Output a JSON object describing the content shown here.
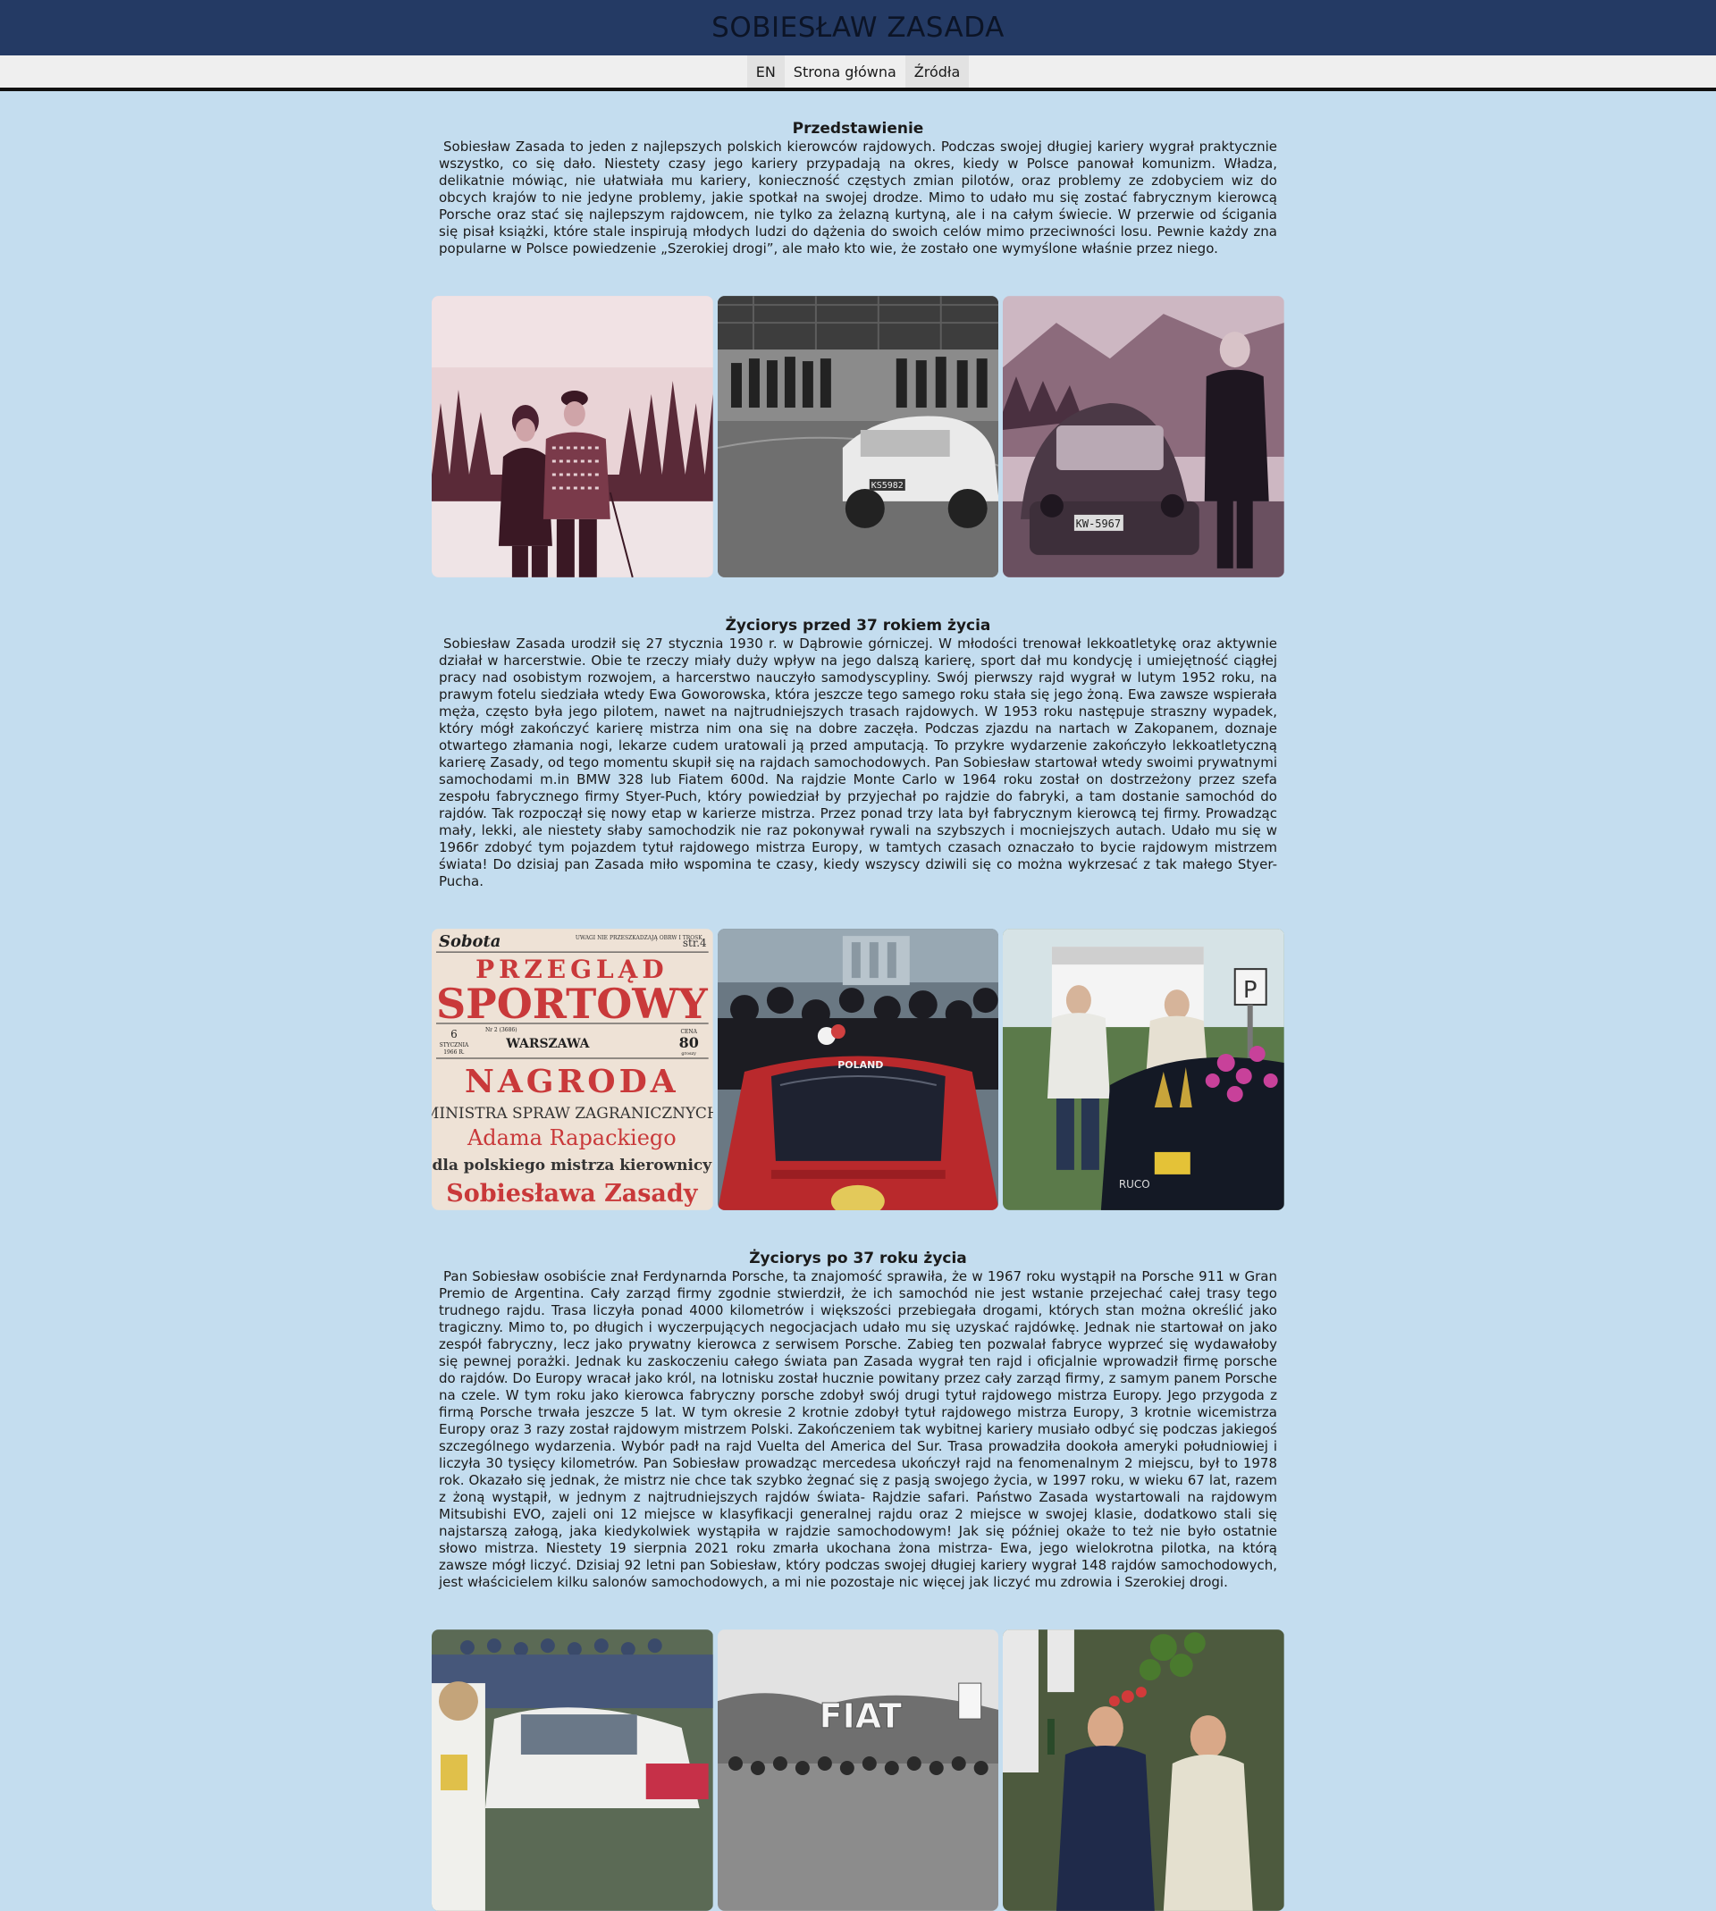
{
  "site": {
    "title": "SOBIESŁAW ZASADA"
  },
  "nav": {
    "items": [
      "EN",
      "Strona główna",
      "Źródła"
    ]
  },
  "sections": [
    {
      "title": "Przedstawienie",
      "text": "Sobiesław Zasada to jeden z najlepszych polskich kierowców rajdowych. Podczas swojej długiej kariery wygrał praktycznie wszystko, co się dało. Niestety czasy jego kariery przypadają na okres, kiedy w Polsce panował komunizm. Władza, delikatnie mówiąc, nie ułatwiała mu kariery, konieczność częstych zmian pilotów, oraz problemy ze zdobyciem wiz do obcych krajów to nie jedyne problemy, jakie spotkał na swojej drodze. Mimo to udało mu się zostać fabrycznym kierowcą Porsche oraz stać się najlepszym rajdowcem, nie tylko za żelazną kurtyną, ale i na całym świecie. W przerwie od ścigania się pisał książki, które stale inspirują młodych ludzi do dążenia do swoich celów mimo przeciwności losu. Pewnie każdy zna popularne w Polsce powiedzenie „Szerokiej drogi”, ale mało kto wie, że zostało one wymyślone właśnie przez niego."
    },
    {
      "title": "Życiorys przed 37 rokiem życia",
      "text": "Sobiesław Zasada urodził się 27 stycznia 1930 r. w Dąbrowie górniczej. W młodości trenował lekkoatletykę oraz aktywnie działał w harcerstwie. Obie te rzeczy miały duży wpływ na jego dalszą karierę, sport dał mu kondycję i umiejętność ciągłej pracy nad osobistym rozwojem, a harcerstwo nauczyło samodyscypliny. Swój pierwszy rajd wygrał w lutym 1952 roku, na prawym fotelu siedziała wtedy Ewa Goworowska, która jeszcze tego samego roku stała się jego żoną. Ewa zawsze wspierała męża, często była jego pilotem, nawet na najtrudniejszych trasach rajdowych. W 1953 roku następuje straszny wypadek, który mógł zakończyć karierę mistrza nim ona się na dobre zaczęła. Podczas zjazdu na nartach w Zakopanem, doznaje otwartego złamania nogi, lekarze cudem uratowali ją przed amputacją. To przykre wydarzenie zakończyło lekkoatletyczną karierę Zasady, od tego momentu skupił się na rajdach samochodowych. Pan Sobiesław startował wtedy swoimi prywatnymi samochodami m.in BMW 328 lub Fiatem 600d. Na rajdzie Monte Carlo w 1964 roku został on dostrzeżony przez szefa zespołu fabrycznego firmy Styer-Puch, który powiedział by przyjechał po rajdzie do fabryki, a tam dostanie samochód do rajdów. Tak rozpoczął się nowy etap w karierze mistrza. Przez ponad trzy lata był fabrycznym kierowcą tej firmy. Prowadząc mały, lekki, ale niestety słaby samochodzik nie raz pokonywał rywali na szybszych i mocniejszych autach. Udało mu się w 1966r zdobyć tym pojazdem tytuł rajdowego mistrza Europy, w tamtych czasach oznaczało to bycie rajdowym mistrzem świata! Do dzisiaj pan Zasada miło wspomina te czasy, kiedy wszyscy dziwili się co można wykrzesać z tak małego Styer-Pucha."
    },
    {
      "title": "Życiorys po 37 roku życia",
      "text": "Pan Sobiesław osobiście znał Ferdynarnda Porsche, ta znajomość sprawiła, że w 1967 roku wystąpił na Porsche 911 w Gran Premio de Argentina. Cały zarząd firmy zgodnie stwierdził, że ich samochód nie jest wstanie przejechać całej trasy tego trudnego rajdu. Trasa liczyła ponad 4000 kilometrów i większości przebiegała drogami, których stan można określić jako tragiczny. Mimo to, po długich i wyczerpujących negocjacjach udało mu się uzyskać rajdówkę. Jednak nie startował on jako zespół fabryczny, lecz jako prywatny kierowca z serwisem Porsche. Zabieg ten pozwalał fabryce wyprzeć się wydawałoby się pewnej porażki. Jednak ku zaskoczeniu całego świata pan Zasada wygrał ten rajd i oficjalnie wprowadził firmę porsche do rajdów. Do Europy wracał jako król, na lotnisku został hucznie powitany przez cały zarząd firmy, z samym panem Porsche na czele. W tym roku jako kierowca fabryczny porsche zdobył swój drugi tytuł rajdowego mistrza Europy. Jego przygoda z firmą Porsche trwała jeszcze 5 lat. W tym okresie 2 krotnie zdobył tytuł rajdowego mistrza Europy, 3 krotnie wicemistrza Europy oraz 3 razy został rajdowym mistrzem Polski. Zakończeniem tak wybitnej kariery musiało odbyć się podczas jakiegoś szczególnego wydarzenia. Wybór padł na rajd Vuelta del America del Sur. Trasa prowadziła dookoła ameryki południowiej i liczyła 30 tysięcy kilometrów. Pan Sobiesław prowadząc mercedesa ukończył rajd na fenomenalnym 2 miejscu, był to 1978 rok. Okazało się jednak, że mistrz nie chce tak szybko żegnać się z pasją swojego życia, w 1997 roku, w wieku 67 lat, razem z żoną wystąpił, w jednym z najtrudniejszych rajdów świata- Rajdzie safari. Państwo Zasada wystartowali na rajdowym Mitsubishi EVO, zajeli oni 12 miejsce w klasyfikacji generalnej rajdu oraz 2 miejsce w swojej klasie, dodatkowo stali się najstarszą załogą, jaka kiedykolwiek wystąpiła w rajdzie samochodowym! Jak się później okaże to też nie było ostatnie słowo mistrza. Niestety 19 sierpnia 2021 roku zmarła ukochana żona mistrza- Ewa, jego wielokrotna pilotka, na którą zawsze mógł liczyć. Dzisiaj 92 letni pan Sobiesław, który podczas swojej długiej kariery wygrał 148 rajdów samochodowych, jest właścicielem kilku salonów samochodowych, a mi nie pozostaje nic więcej jak liczyć mu zdrowia i Szerokiej drogi."
    }
  ],
  "photos": {
    "car_plate_1": "KS5982",
    "car_plate_2": "KW-5967",
    "newspaper": {
      "masthead_day": "Sobota",
      "top_note": "UWAGI NIE PRZESZKADZAJĄ OBRW I TROSK",
      "page": "str.4",
      "title_1": "PRZEGLĄD",
      "title_2": "SPORTOWY",
      "date_day": "6",
      "date_month": "STYCZNIA",
      "date_year": "1966 R.",
      "issue": "Nr 2 (3686)",
      "city": "WARSZAWA",
      "price_label": "CENA",
      "price": "80",
      "price_unit": "groszy",
      "headline_1": "NAGRODA",
      "headline_2": "MINISTRA SPRAW ZAGRANICZNYCH",
      "headline_3": "Adama Rapackiego",
      "headline_4": "dla polskiego mistrza kierownicy",
      "headline_5": "Sobiesława Zasady"
    },
    "car_plate_3": "POLAND",
    "parking_sign": "P",
    "fiat_sign": "FIAT"
  }
}
